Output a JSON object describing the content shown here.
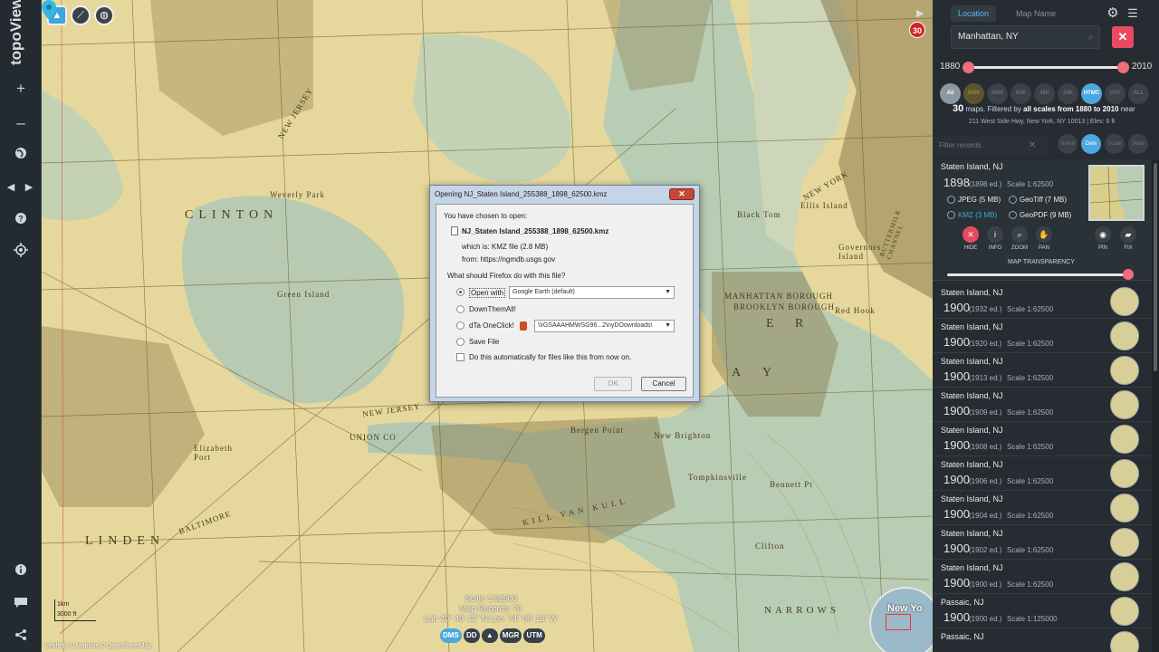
{
  "app": {
    "logo": "topoView"
  },
  "rail": {
    "zoom_in": "+",
    "zoom_out": "–"
  },
  "map": {
    "badge_count": "30",
    "labels": [
      "CLINTON",
      "NEW JERSEY",
      "NEW YORK",
      "MANHATTAN BOROUGH",
      "BROOKLYN BOROUGH",
      "Black Tom",
      "Ellis Island",
      "Governors Island",
      "Red Hook",
      "Elizabeth Port",
      "BALTIMORE",
      "LINDEN",
      "New Brighton",
      "Tompkinsville",
      "NARROWS",
      "Clifton",
      "Bennett Pt",
      "Green Island",
      "UNION CO",
      "Weverly Park",
      "BUTTERMILK CHANNEL",
      "KILL VAN KULL",
      "NEW JERSEY",
      "Bergen Point"
    ],
    "big_letters": [
      "A",
      "Y",
      "E",
      "R"
    ],
    "scale": {
      "top": "1km",
      "bottom": "3000 ft"
    },
    "info": [
      "Scale 1:62500",
      "Map Records: 70",
      "Lat: 40° 40' 12\" N  Lon: 74° 06' 13\" W"
    ],
    "chips": [
      "DMS",
      "DD",
      "▲",
      "MGR",
      "UTM"
    ],
    "attribution": "Leaflet | © Mapbox © OpenStreetMap",
    "minimap_label": "New Yo"
  },
  "dialog": {
    "title": "Opening NJ_Staten Island_255388_1898_62500.kmz",
    "close": "✕",
    "intro": "You have chosen to open:",
    "filename": "NJ_Staten Island_255388_1898_62500.kmz",
    "which_is": "which is:  KMZ file (2.8 MB)",
    "from": "from:  https://ngmdb.usgs.gov",
    "question": "What should Firefox do with this file?",
    "open_with_label": "Open with",
    "open_with_value": "Google Earth (default)",
    "option2": "DownThemAll!",
    "option3": "dTa OneClick!",
    "option3_path": "\\\\IGSAAAHMWSG96...2\\nyDOownloads\\",
    "option4": "Save File",
    "auto_checkbox": "Do this automatically for files like this from now on.",
    "ok": "OK",
    "cancel": "Cancel"
  },
  "panel": {
    "tabs": [
      "Location",
      "Map Name"
    ],
    "location_value": "Manhattan, NY",
    "clear": "✕",
    "year_min": "1880",
    "year_max": "2010",
    "scales": [
      "All",
      "250K",
      "100K",
      "63K",
      "48K",
      "24K",
      "HTMC",
      "UST",
      "ALL"
    ],
    "summary_count": "30",
    "summary_text1": " maps. Filtered by ",
    "summary_bold1": "all scales from 1880 to 2010",
    "summary_text2": " near",
    "summary_address": "211 West Side Hwy, New York, NY 10013 | Elev: 6 ft",
    "filter_placeholder": "Filter records",
    "sort": [
      "Name",
      "Date",
      "Scale",
      "State"
    ],
    "selected": {
      "name": "Staten Island, NJ",
      "year": "1898",
      "edition": "(1898 ed.)",
      "scale": "Scale 1:62500",
      "downloads": [
        "JPEG (5 MB)",
        "GeoTiff (7 MB)",
        "KMZ (3 MB)",
        "GeoPDF (9 MB)"
      ],
      "tools": [
        "HIDE",
        "INFO",
        "ZOOM",
        "PAN",
        "PIN",
        "FIX"
      ],
      "transparency_label": "MAP TRANSPARENCY"
    },
    "records": [
      {
        "name": "Staten Island, NJ",
        "year": "1900",
        "edition": "(1932 ed.)",
        "scale": "Scale 1:62500"
      },
      {
        "name": "Staten Island, NJ",
        "year": "1900",
        "edition": "(1920 ed.)",
        "scale": "Scale 1:62500"
      },
      {
        "name": "Staten Island, NJ",
        "year": "1900",
        "edition": "(1913 ed.)",
        "scale": "Scale 1:62500"
      },
      {
        "name": "Staten Island, NJ",
        "year": "1900",
        "edition": "(1909 ed.)",
        "scale": "Scale 1:62500"
      },
      {
        "name": "Staten Island, NJ",
        "year": "1900",
        "edition": "(1908 ed.)",
        "scale": "Scale 1:62500"
      },
      {
        "name": "Staten Island, NJ",
        "year": "1900",
        "edition": "(1906 ed.)",
        "scale": "Scale 1:62500"
      },
      {
        "name": "Staten Island, NJ",
        "year": "1900",
        "edition": "(1904 ed.)",
        "scale": "Scale 1:62500"
      },
      {
        "name": "Staten Island, NJ",
        "year": "1900",
        "edition": "(1902 ed.)",
        "scale": "Scale 1:62500"
      },
      {
        "name": "Staten Island, NJ",
        "year": "1900",
        "edition": "(1900 ed.)",
        "scale": "Scale 1:62500"
      },
      {
        "name": "Passaic, NJ",
        "year": "1900",
        "edition": "(1900 ed.)",
        "scale": "Scale 1:125000"
      },
      {
        "name": "Passaic, NJ",
        "year": "",
        "edition": "",
        "scale": ""
      }
    ]
  }
}
